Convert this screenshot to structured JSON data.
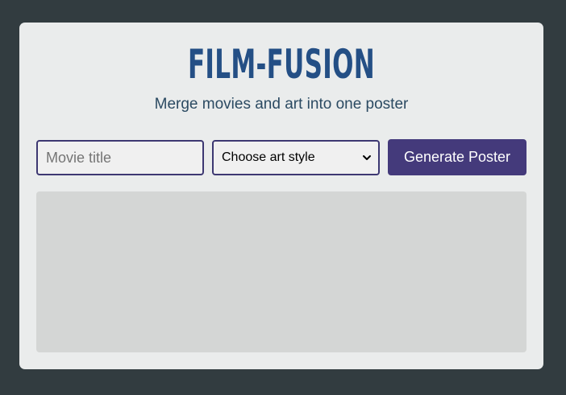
{
  "app": {
    "title": "FILM-FUSION",
    "subtitle": "Merge movies and art into one poster"
  },
  "form": {
    "movie_input": {
      "placeholder": "Movie title",
      "value": ""
    },
    "style_select": {
      "selected": "Choose art style",
      "icon": "chevron-down-icon"
    },
    "generate_label": "Generate Poster"
  },
  "colors": {
    "background": "#323c40",
    "card": "#eaecec",
    "title": "#244f85",
    "accent": "#443a7b",
    "poster_placeholder": "#d4d6d5"
  }
}
